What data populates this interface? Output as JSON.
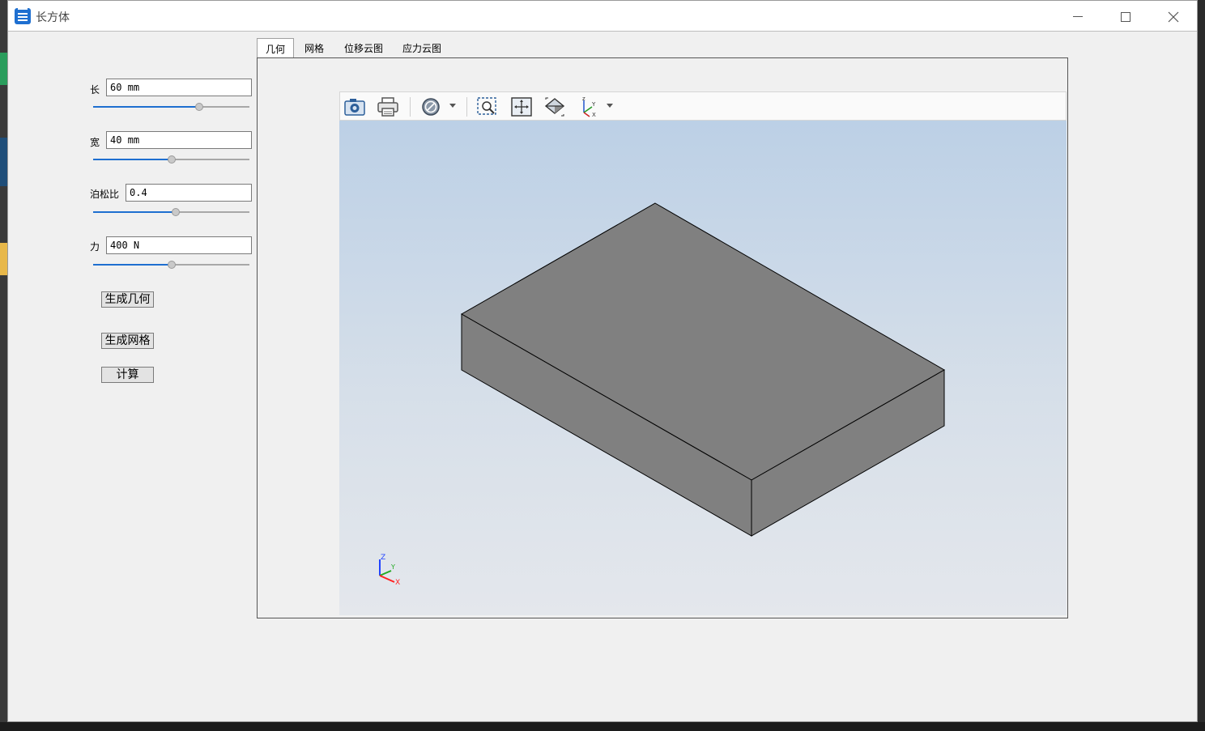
{
  "window": {
    "title": "长方体"
  },
  "params": {
    "length": {
      "label": "长",
      "value": "60 mm",
      "slider": 0.68
    },
    "width": {
      "label": "宽",
      "value": "40 mm",
      "slider": 0.5
    },
    "poisson": {
      "label": "泊松比",
      "value": "0.4",
      "slider": 0.53
    },
    "force": {
      "label": "力",
      "value": "400 N",
      "slider": 0.5
    }
  },
  "buttons": {
    "gen_geometry": "生成几何",
    "gen_mesh": "生成网格",
    "compute": "计算"
  },
  "tabs": [
    {
      "label": "几何",
      "active": true
    },
    {
      "label": "网格",
      "active": false
    },
    {
      "label": "位移云图",
      "active": false
    },
    {
      "label": "应力云图",
      "active": false
    }
  ],
  "viewer": {
    "toolbar": [
      "camera-icon",
      "print-icon",
      "display-mode-icon",
      "zoom-box-icon",
      "fit-all-icon",
      "isometric-view-icon",
      "axis-view-icon"
    ],
    "triad": {
      "z": "Z",
      "y": "Y",
      "x": "X"
    },
    "colors": {
      "box_face": "#808080",
      "edge": "#000000",
      "accent": "#1e6fd0"
    }
  }
}
